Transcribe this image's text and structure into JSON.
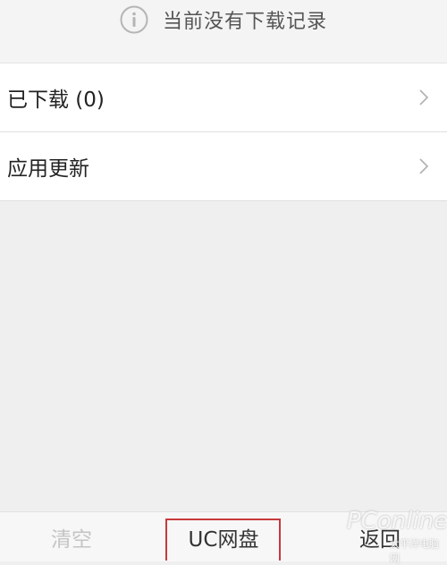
{
  "notice": {
    "icon": "info-icon",
    "text": "当前没有下载记录"
  },
  "list": {
    "items": [
      {
        "label": "已下载 (0)",
        "icon": "chevron-right-icon"
      },
      {
        "label": "应用更新",
        "icon": "chevron-right-icon"
      }
    ]
  },
  "toolbar": {
    "clear_label": "清空",
    "cloud_label": "UC网盘",
    "back_label": "返回"
  },
  "watermark": {
    "logo_text": "PConline",
    "sub_text": "太平洋电脑网"
  },
  "colors": {
    "background": "#efefef",
    "highlight_border": "#c8393c",
    "disabled_text": "#c4c4c4"
  }
}
